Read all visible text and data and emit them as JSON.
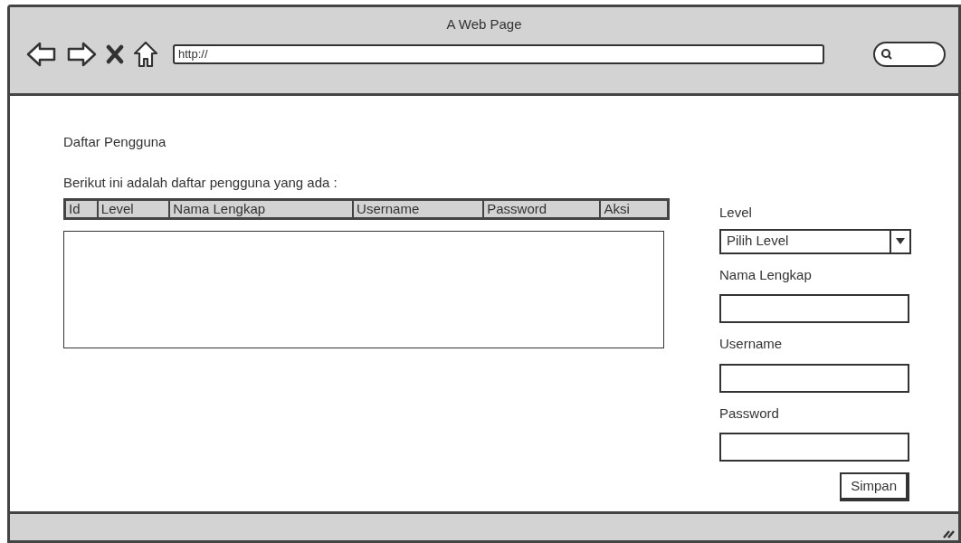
{
  "window": {
    "title": "A Web Page"
  },
  "address_bar": {
    "value": "http://"
  },
  "page": {
    "heading": "Daftar Pengguna",
    "intro": "Berikut ini adalah daftar pengguna yang ada :"
  },
  "table": {
    "columns": [
      "Id",
      "Level",
      "Nama Lengkap",
      "Username",
      "Password",
      "Aksi"
    ]
  },
  "form": {
    "fields": [
      {
        "kind": "select",
        "label": "Level",
        "value": "Pilih Level"
      },
      {
        "kind": "text",
        "label": "Nama Lengkap"
      },
      {
        "kind": "text",
        "label": "Username"
      },
      {
        "kind": "text",
        "label": "Password"
      }
    ],
    "button": "Simpan"
  }
}
